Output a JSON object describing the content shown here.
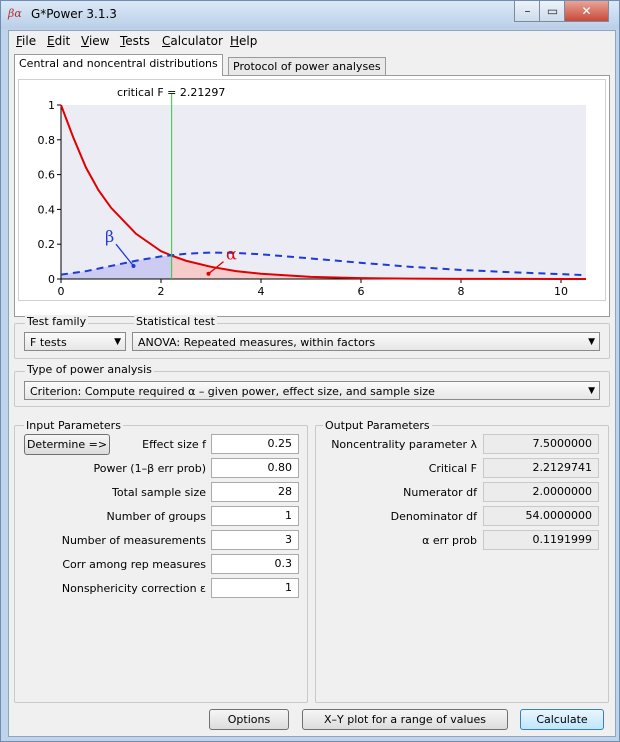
{
  "window": {
    "title": "G*Power 3.1.3",
    "icon": "beta-alpha-app-icon"
  },
  "menu": [
    {
      "key": "F",
      "rest": "ile"
    },
    {
      "key": "E",
      "rest": "dit"
    },
    {
      "key": "V",
      "rest": "iew"
    },
    {
      "key": "T",
      "rest": "ests"
    },
    {
      "key": "C",
      "rest": "alculator"
    },
    {
      "key": "H",
      "rest": "elp"
    }
  ],
  "tabs": {
    "distributions": "Central and noncentral distributions",
    "protocol": "Protocol of power analyses"
  },
  "chart": {
    "critical_label": "critical F = 2.21297",
    "beta_symbol": "β",
    "alpha_symbol": "α",
    "x_ticks": [
      "0",
      "2",
      "4",
      "6",
      "8",
      "10"
    ],
    "y_ticks": [
      "0",
      "0.2",
      "0.4",
      "0.6",
      "0.8",
      "1"
    ]
  },
  "chart_data": {
    "type": "line",
    "xlim": [
      0,
      10.5
    ],
    "ylim": [
      0,
      1
    ],
    "critical_x": 2.21297,
    "series": [
      {
        "color": "#e00000",
        "style": "solid",
        "x": [
          0,
          0.25,
          0.5,
          0.75,
          1,
          1.5,
          2,
          2.21,
          2.5,
          3,
          3.5,
          4,
          5,
          6,
          7,
          8,
          10,
          10.5
        ],
        "y": [
          1,
          0.81,
          0.64,
          0.51,
          0.41,
          0.26,
          0.16,
          0.135,
          0.105,
          0.07,
          0.045,
          0.03,
          0.012,
          0.005,
          0.002,
          0.001,
          0.0,
          0.0
        ]
      },
      {
        "color": "#1f3bd6",
        "style": "dashed",
        "x": [
          0,
          0.5,
          1,
          1.5,
          2,
          2.5,
          3,
          3.5,
          4,
          4.5,
          5,
          6,
          7,
          8,
          9,
          10,
          10.5
        ],
        "y": [
          0.025,
          0.045,
          0.075,
          0.105,
          0.13,
          0.145,
          0.152,
          0.15,
          0.142,
          0.13,
          0.118,
          0.093,
          0.07,
          0.052,
          0.039,
          0.028,
          0.022
        ]
      }
    ]
  },
  "test_family": {
    "label": "Test family",
    "value": "F tests"
  },
  "statistical_test": {
    "label": "Statistical test",
    "value": "ANOVA: Repeated measures, within factors"
  },
  "power_analysis": {
    "label": "Type of power analysis",
    "value": "Criterion: Compute required α – given power, effect size, and sample size"
  },
  "input": {
    "title": "Input Parameters",
    "determine_label": "Determine =>",
    "fields": [
      {
        "label": "Effect size f",
        "value": "0.25"
      },
      {
        "label": "Power (1–β err prob)",
        "value": "0.80"
      },
      {
        "label": "Total sample size",
        "value": "28"
      },
      {
        "label": "Number of groups",
        "value": "1"
      },
      {
        "label": "Number of measurements",
        "value": "3"
      },
      {
        "label": "Corr among rep measures",
        "value": "0.3"
      },
      {
        "label": "Nonsphericity correction ε",
        "value": "1"
      }
    ]
  },
  "output": {
    "title": "Output Parameters",
    "fields": [
      {
        "label": "Noncentrality parameter λ",
        "value": "7.5000000"
      },
      {
        "label": "Critical F",
        "value": "2.2129741"
      },
      {
        "label": "Numerator df",
        "value": "2.0000000"
      },
      {
        "label": "Denominator df",
        "value": "54.0000000"
      },
      {
        "label": "α err prob",
        "value": "0.1191999"
      }
    ]
  },
  "buttons": {
    "options": "Options",
    "xy_plot": "X–Y plot for a range of values",
    "calculate": "Calculate"
  }
}
